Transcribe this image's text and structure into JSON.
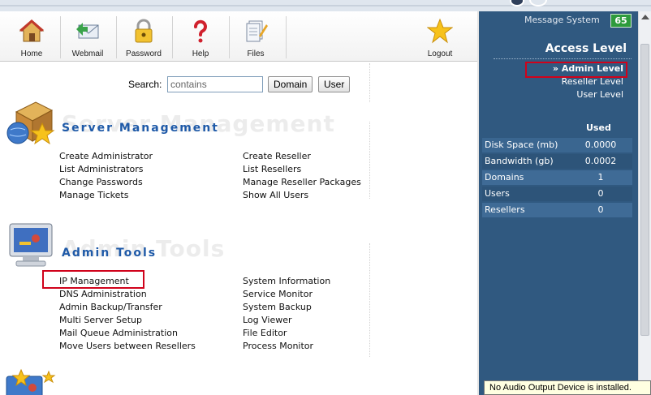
{
  "toolbar": {
    "items": [
      {
        "label": "Home",
        "icon": "home-icon"
      },
      {
        "label": "Webmail",
        "icon": "webmail-icon"
      },
      {
        "label": "Password",
        "icon": "lock-icon"
      },
      {
        "label": "Help",
        "icon": "help-icon"
      },
      {
        "label": "Files",
        "icon": "files-icon"
      },
      {
        "label": "Logout",
        "icon": "star-icon"
      }
    ]
  },
  "search": {
    "label": "Search:",
    "placeholder": "contains",
    "value": "",
    "domain_button": "Domain",
    "user_button": "User"
  },
  "server_management": {
    "title": "Server Management",
    "ghost": "Server Management",
    "links_left": [
      "Create Administrator",
      "List Administrators",
      "Change Passwords",
      "Manage Tickets"
    ],
    "links_right": [
      "Create Reseller",
      "List Resellers",
      "Manage Reseller Packages",
      "Show All Users"
    ]
  },
  "admin_tools": {
    "title": "Admin Tools",
    "ghost": "Admin Tools",
    "links_left": [
      "IP Management",
      "DNS Administration",
      "Admin Backup/Transfer",
      "Multi Server Setup",
      "Mail Queue Administration",
      "Move Users between Resellers"
    ],
    "links_right": [
      "System Information",
      "Service Monitor",
      "System Backup",
      "Log Viewer",
      "File Editor",
      "Process Monitor"
    ]
  },
  "right_panel": {
    "message_label": "Message System",
    "message_count": "65",
    "access_title": "Access Level",
    "levels": [
      "» Admin Level",
      "Reseller Level",
      "User Level"
    ],
    "used_header": "Used",
    "stats": [
      {
        "label": "Disk Space (mb)",
        "value": "0.0000"
      },
      {
        "label": "Bandwidth (gb)",
        "value": "0.0002"
      },
      {
        "label": "Domains",
        "value": "1"
      },
      {
        "label": "Users",
        "value": "0"
      },
      {
        "label": "Resellers",
        "value": "0"
      }
    ]
  },
  "tooltip": "No Audio Output Device is installed.",
  "colors": {
    "accent": "#1f5aa8",
    "panel": "#305980",
    "highlight": "#d0021b",
    "badge": "#2e9b3c"
  }
}
